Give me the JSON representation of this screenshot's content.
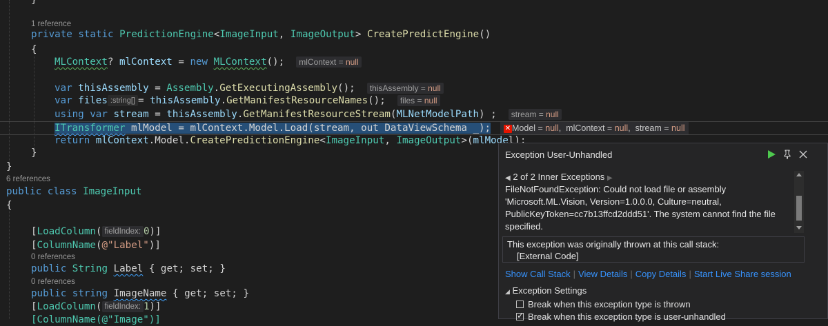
{
  "code": {
    "ref1": "1 reference",
    "ref6": "6 references",
    "ref0a": "0 references",
    "ref0b": "0 references",
    "line_close_brace_top": "}",
    "method_sig": {
      "kw1": "private",
      "kw2": "static",
      "type1": "PredictionEngine",
      "lt": "<",
      "type2": "ImageInput",
      "comma": ", ",
      "type3": "ImageOutput",
      "gt": "> ",
      "name": "CreatePredictEngine",
      "parens": "()"
    },
    "open_brace": "{",
    "l_mlcontext": {
      "type": "MLContext",
      "q": "? ",
      "var": "mlContext",
      "eq": " = ",
      "kw": "new",
      "sp": " ",
      "type2": "MLContext",
      "tail": "();",
      "hint_name": "mlContext = ",
      "hint_val": "null"
    },
    "l_assembly": {
      "kw": "var",
      "var": "thisAssembly",
      "eq": " = ",
      "type": "Assembly",
      "dot": ".",
      "fn": "GetExecutingAssembly",
      "tail": "();",
      "hint_name": "thisAssembly = ",
      "hint_val": "null"
    },
    "l_files": {
      "kw": "var",
      "var": "files",
      "typehint": ":string[]",
      "eq": "= ",
      "var2": "thisAssembly",
      "dot": ".",
      "fn": "GetManifestResourceNames",
      "tail": "();",
      "hint_name": "files = ",
      "hint_val": "null"
    },
    "l_stream": {
      "kw1": "using",
      "kw2": "var",
      "var": "stream",
      "eq": " = ",
      "var2": "thisAssembly",
      "dot": ".",
      "fn": "GetManifestResourceStream",
      "open": "(",
      "arg": "MLNetModelPath",
      "tail": ") ;",
      "hint_name": "stream = ",
      "hint_val": "null"
    },
    "l_model": {
      "type": "ITransformer",
      "rest": " mlModel = mlContext.Model.Load(stream, out DataViewSchema _);",
      "tip1_name": "Model = ",
      "tip1_val": "null",
      "tip2_name": "mlContext = ",
      "tip2_val": "null",
      "tip3_name": "stream = ",
      "tip3_val": "null",
      "sep": ",  "
    },
    "l_return": {
      "kw": "return",
      "var": "mlContext",
      "mid": ".Model.",
      "fn": "CreatePredictionEngine",
      "lt": "<",
      "type1": "ImageInput",
      "comma": ", ",
      "type2": "ImageOutput",
      "gt": ">",
      "open": "(",
      "arg": "mlMode",
      "tail": "l);"
    },
    "close_brace_inner": "}",
    "close_brace_outer": "}",
    "class_decl": {
      "kw1": "public",
      "kw2": "class",
      "name": "ImageInput"
    },
    "class_open": "{",
    "load_col0": {
      "open": "[",
      "type": "LoadColumn",
      "p": "(",
      "hint": "fieldIndex:",
      "num": "0",
      "tail": ")]"
    },
    "colname": {
      "open": "[",
      "type": "ColumnName",
      "p": "(",
      "str": "@\"Label\"",
      "tail": ")]"
    },
    "prop_label": {
      "kw": "public",
      "type": "String",
      "name": "Label",
      "body": " { get; set; }"
    },
    "prop_imagename": {
      "kw": "public",
      "type": "string",
      "name": "ImageName",
      "body": " { get; set; }"
    },
    "load_col1": {
      "open": "[",
      "type": "LoadColumn",
      "p": "(",
      "hint": "fieldIndex:",
      "num": "1",
      "tail": ")]"
    },
    "colname_partial": "[ColumnName(@\"Image\")]"
  },
  "exception": {
    "title": "Exception User-Unhandled",
    "inner_nav": "2 of 2 Inner Exceptions",
    "message": "FileNotFoundException: Could not load file or assembly 'Microsoft.ML.Vision, Version=1.0.0.0, Culture=neutral, PublicKeyToken=cc7b13ffcd2ddd51'. The system cannot find the file specified.",
    "stack_line1": "This exception was originally thrown at this call stack:",
    "stack_line2": "[External Code]",
    "links": [
      "Show Call Stack",
      "View Details",
      "Copy Details",
      "Start Live Share session"
    ],
    "settings_header": "Exception Settings",
    "options": [
      {
        "label": "Break when this exception type is thrown",
        "checked": false
      },
      {
        "label": "Break when this exception type is user-unhandled",
        "checked": true
      }
    ],
    "buttons": {
      "continue_icon": "play-icon",
      "pin_icon": "pin-icon",
      "close_icon": "close-icon"
    }
  },
  "colors": {
    "keyword": "#569cd6",
    "type": "#4ec9b0",
    "method": "#dcdcaa",
    "variable": "#9cdcfe",
    "null": "#d69d85",
    "link": "#3794ff",
    "continue": "#4ec94e",
    "error": "#e51400"
  }
}
